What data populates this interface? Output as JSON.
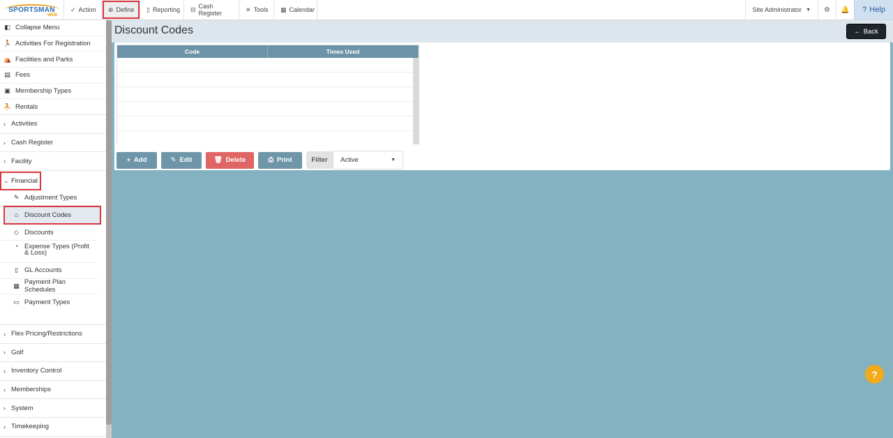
{
  "app": {
    "logo_text": "SPORTSMAN",
    "logo_sub": "WEB"
  },
  "topnav": {
    "items": [
      {
        "label": "Action",
        "icon": "check-icon",
        "glyph": "✓"
      },
      {
        "label": "Define",
        "icon": "plus-circle-icon",
        "glyph": "⊕"
      },
      {
        "label": "Reporting",
        "icon": "document-icon",
        "glyph": "▯"
      },
      {
        "label": "Cash Register",
        "icon": "cash-register-icon",
        "glyph": "⊟"
      },
      {
        "label": "Tools",
        "icon": "tools-icon",
        "glyph": "✕"
      },
      {
        "label": "Calendar",
        "icon": "calendar-icon",
        "glyph": "▦"
      }
    ],
    "user": "Site Administrator",
    "help_label": "Help"
  },
  "sidebar": {
    "top_items": [
      {
        "label": "Collapse Menu",
        "glyph": "◧"
      },
      {
        "label": "Activities For Registration",
        "glyph": "🏃"
      },
      {
        "label": "Facilities and Parks",
        "glyph": "⛺"
      },
      {
        "label": "Fees",
        "glyph": "▤"
      },
      {
        "label": "Membership Types",
        "glyph": "▣"
      },
      {
        "label": "Rentals",
        "glyph": "⛹"
      }
    ],
    "groups_before": [
      "Activities",
      "Cash Register",
      "Facility"
    ],
    "open_group": "Financial",
    "financial_items": [
      {
        "label": "Adjustment Types",
        "glyph": "✎"
      },
      {
        "label": "Discount Codes",
        "glyph": "⌂"
      },
      {
        "label": "Discounts",
        "glyph": "◇"
      },
      {
        "label": "Expense Types (Profit & Loss)",
        "glyph": "◔"
      },
      {
        "label": "GL Accounts",
        "glyph": "▯"
      },
      {
        "label": "Payment Plan Schedules",
        "glyph": "▦"
      },
      {
        "label": "Payment Types",
        "glyph": "▭"
      }
    ],
    "groups_after": [
      "Flex Pricing/Restrictions",
      "Golf",
      "Inventory Control",
      "Memberships",
      "System",
      "Timekeeping"
    ]
  },
  "main": {
    "title": "Discount Codes",
    "back_label": "Back",
    "grid": {
      "columns": [
        "Code",
        "Times Used"
      ]
    },
    "buttons": {
      "add": "Add",
      "edit": "Edit",
      "delete": "Delete",
      "print": "Print"
    },
    "filter": {
      "label": "Filter",
      "value": "Active"
    }
  },
  "colors": {
    "accent": "#6f95a9",
    "danger": "#e06666",
    "background": "#84b2c0",
    "help": "#f2a91a"
  }
}
